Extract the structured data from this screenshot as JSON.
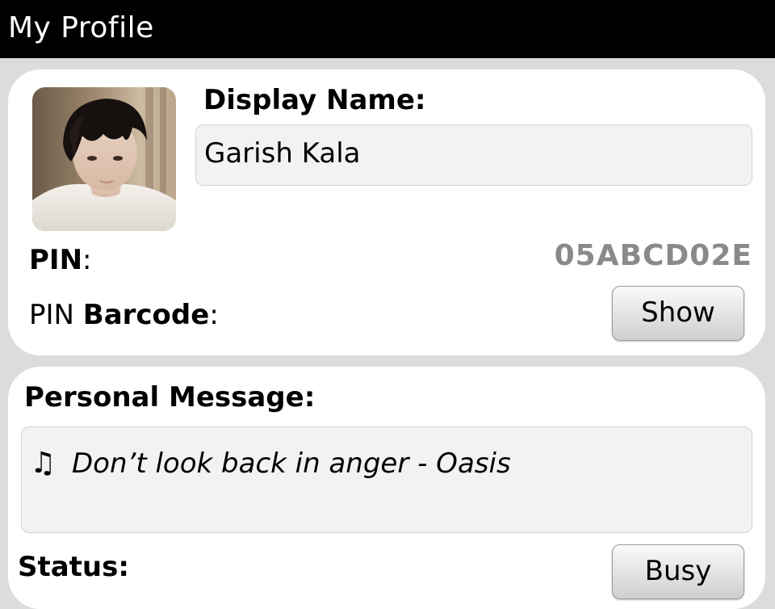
{
  "window": {
    "title": "My Profile"
  },
  "profile": {
    "display_name_label": "Display Name:",
    "display_name_value": "Garish Kala",
    "pin_label": "PIN",
    "pin_colon": ":",
    "pin_value": "05ABCD02E",
    "pin_barcode_label_prefix": "PIN ",
    "pin_barcode_label_bold": "Barcode",
    "pin_barcode_colon": ":",
    "show_button_label": "Show"
  },
  "message": {
    "personal_message_label": "Personal Message:",
    "music_icon": "♫",
    "personal_message_value": "Don’t look back in anger - Oasis",
    "status_label": "Status:",
    "status_button_label": "Busy"
  },
  "colors": {
    "titlebar_bg": "#000000",
    "titlebar_text": "#ffffff",
    "page_bg": "#dcdcdc",
    "panel_bg": "#ffffff",
    "pin_value_color": "#8a8a8a"
  }
}
